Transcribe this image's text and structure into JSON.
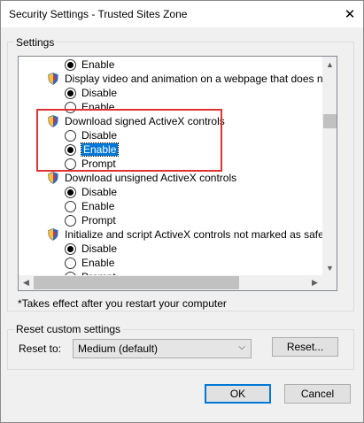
{
  "window": {
    "title": "Security Settings - Trusted Sites Zone",
    "close_symbol": "✕"
  },
  "settings_group": {
    "label": "Settings",
    "rows": [
      {
        "type": "radio",
        "label": "Enable",
        "checked": true
      },
      {
        "type": "header",
        "label": "Display video and animation on a webpage that does not use",
        "icon": "shield-icon"
      },
      {
        "type": "radio",
        "label": "Disable",
        "checked": true
      },
      {
        "type": "radio",
        "label": "Enable",
        "checked": false
      },
      {
        "type": "header",
        "label": "Download signed ActiveX controls",
        "icon": "shield-icon"
      },
      {
        "type": "radio",
        "label": "Disable",
        "checked": false
      },
      {
        "type": "radio",
        "label": "Enable",
        "checked": true,
        "selected": true
      },
      {
        "type": "radio",
        "label": "Prompt",
        "checked": false
      },
      {
        "type": "header",
        "label": "Download unsigned ActiveX controls",
        "icon": "shield-icon"
      },
      {
        "type": "radio",
        "label": "Disable",
        "checked": true
      },
      {
        "type": "radio",
        "label": "Enable",
        "checked": false
      },
      {
        "type": "radio",
        "label": "Prompt",
        "checked": false
      },
      {
        "type": "header",
        "label": "Initialize and script ActiveX controls not marked as safe for sc",
        "icon": "shield-icon"
      },
      {
        "type": "radio",
        "label": "Disable",
        "checked": true
      },
      {
        "type": "radio",
        "label": "Enable",
        "checked": false
      },
      {
        "type": "radio",
        "label": "Prompt",
        "checked": false
      }
    ],
    "note": "*Takes effect after you restart your computer"
  },
  "reset_group": {
    "label": "Reset custom settings",
    "reset_to_label": "Reset to:",
    "reset_to_value": "Medium (default)",
    "reset_button": "Reset..."
  },
  "footer": {
    "ok": "OK",
    "cancel": "Cancel"
  },
  "colors": {
    "highlight_box": "#e23333",
    "selection": "#0078d7"
  }
}
